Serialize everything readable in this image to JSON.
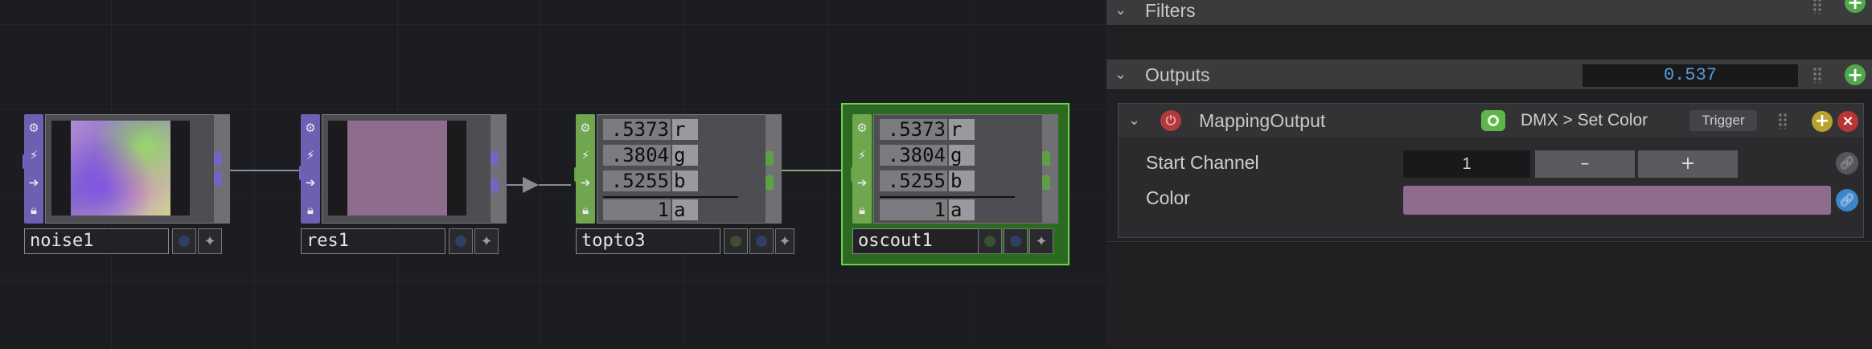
{
  "colors": {
    "top_purple": "#6f5fb3",
    "chop_green": "#6fa64e",
    "selection_green": "#6ed04f",
    "swatch": "#8d6c8c",
    "value_blue": "#5b9bd8"
  },
  "network": {
    "operators": [
      {
        "name": "noise1",
        "family": "TOP",
        "viewer": "noise-image"
      },
      {
        "name": "res1",
        "family": "TOP",
        "viewer": "flat-color",
        "color": "#8d6c8c"
      },
      {
        "name": "topto3",
        "family": "CHOP",
        "channels": [
          {
            "value": ".5373",
            "name": "r"
          },
          {
            "value": ".3804",
            "name": "g"
          },
          {
            "value": ".5255",
            "name": "b"
          },
          {
            "value": "1",
            "name": "a"
          }
        ]
      },
      {
        "name": "oscout1",
        "family": "CHOP",
        "selected": true,
        "channels": [
          {
            "value": ".5373",
            "name": "r"
          },
          {
            "value": ".3804",
            "name": "g"
          },
          {
            "value": ".5255",
            "name": "b"
          },
          {
            "value": "1",
            "name": "a"
          }
        ]
      }
    ],
    "strip_icons": [
      "gear-icon",
      "bolt-icon",
      "arrow-right-icon",
      "lock-icon"
    ]
  },
  "panel": {
    "filters": {
      "title": "Filters"
    },
    "outputs": {
      "title": "Outputs",
      "value": "0.537",
      "mapping": {
        "name": "MappingOutput",
        "action": "DMX > Set Color",
        "trigger_label": "Trigger",
        "start_channel": {
          "label": "Start Channel",
          "value": "1",
          "minus": "–",
          "plus": "+"
        },
        "color": {
          "label": "Color",
          "value": "#8d6c8c"
        }
      }
    }
  }
}
